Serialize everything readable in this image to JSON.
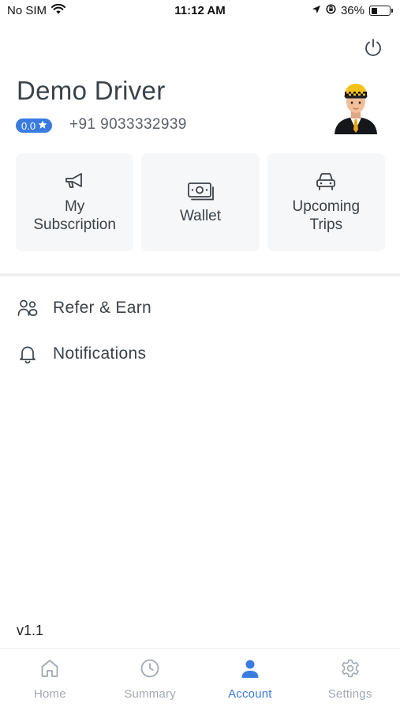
{
  "status_bar": {
    "carrier": "No SIM",
    "time": "11:12 AM",
    "battery_percent": "36%",
    "battery_level": 0.36,
    "icons": [
      "wifi-icon",
      "location-arrow-icon",
      "orientation-lock-icon",
      "battery-icon"
    ]
  },
  "header": {
    "power_icon": "power-icon"
  },
  "profile": {
    "name": "Demo Driver",
    "rating": "0.0",
    "rating_icon": "star-icon",
    "phone": "+91 9033332939",
    "avatar_icon": "taxi-driver-avatar"
  },
  "tiles": [
    {
      "label": "My Subscription",
      "icon": "megaphone-icon"
    },
    {
      "label": "Wallet",
      "icon": "cash-icon"
    },
    {
      "label": "Upcoming Trips",
      "icon": "car-icon"
    }
  ],
  "menu": [
    {
      "label": "Refer & Earn",
      "icon": "users-icon"
    },
    {
      "label": "Notifications",
      "icon": "bell-icon"
    }
  ],
  "version": "v1.1",
  "tabbar": {
    "active": "Account",
    "accent_color": "#3a7be0",
    "inactive_color": "#a3a9b0",
    "tabs": [
      {
        "label": "Home",
        "icon": "home-icon"
      },
      {
        "label": "Summary",
        "icon": "clock-icon"
      },
      {
        "label": "Account",
        "icon": "user-icon"
      },
      {
        "label": "Settings",
        "icon": "gear-icon"
      }
    ]
  }
}
